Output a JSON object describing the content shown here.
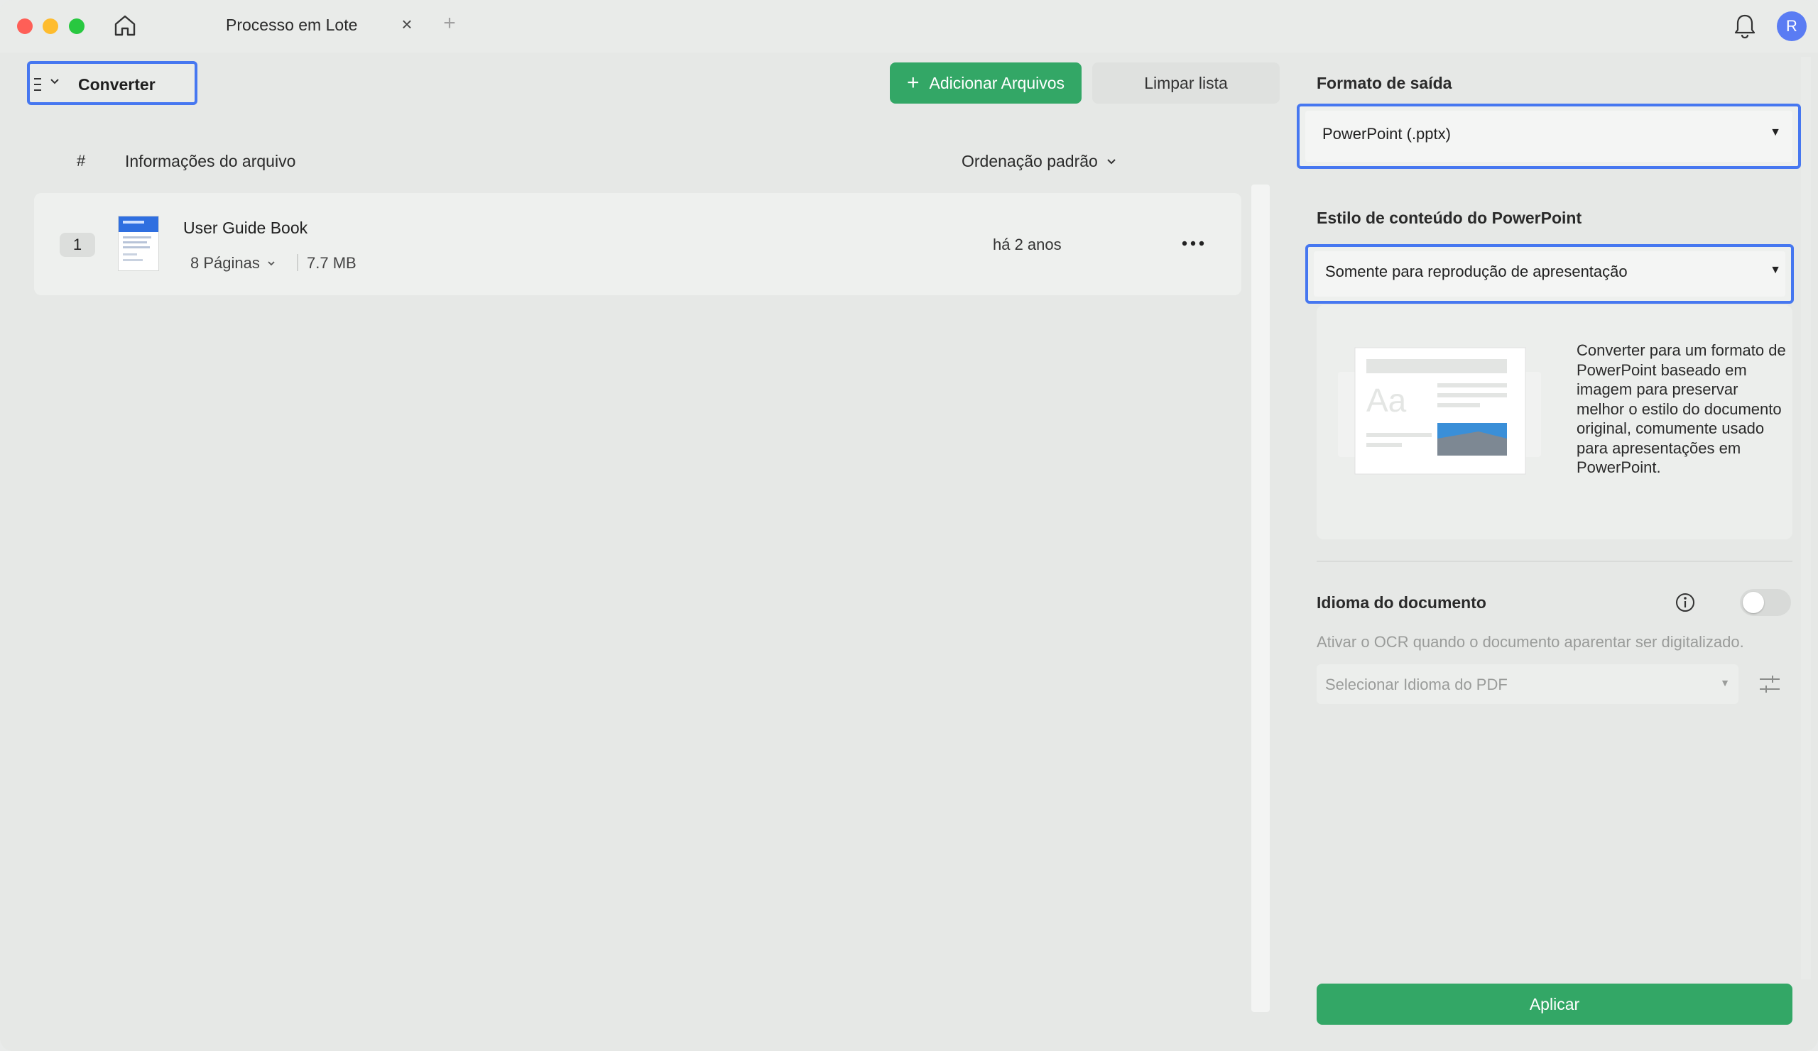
{
  "window": {
    "tab_title": "Processo em Lote",
    "tab_close": "×",
    "tab_add": "+",
    "avatar_initial": "R"
  },
  "toolbar": {
    "mode_label": "Converter",
    "add_files_label": "Adicionar Arquivos",
    "add_files_icon": "plus-icon",
    "clear_list_label": "Limpar lista"
  },
  "list": {
    "header": {
      "num": "#",
      "info": "Informações do arquivo",
      "sort": "Ordenação padrão"
    },
    "files": [
      {
        "index": "1",
        "name": "User Guide Book",
        "pages": "8 Páginas",
        "size": "7.7 MB",
        "date": "há 2 anos"
      }
    ]
  },
  "settings": {
    "output_format_title": "Formato de saída",
    "output_format_value": "PowerPoint (.pptx)",
    "content_style_title": "Estilo de conteúdo do PowerPoint",
    "content_style_value": "Somente para reprodução de apresentação",
    "content_style_description": "Converter para um formato de PowerPoint baseado em imagem para preservar melhor o estilo do documento original, comumente usado para apresentações em PowerPoint.",
    "document_language_title": "Idioma do documento",
    "ocr_hint": "Ativar o OCR quando o documento aparentar ser digitalizado.",
    "language_placeholder": "Selecionar Idioma do PDF",
    "ocr_enabled": false,
    "apply_label": "Aplicar"
  },
  "colors": {
    "accent_green": "#33a766",
    "highlight_blue": "#4677f0",
    "avatar_blue": "#5a7cf3"
  }
}
